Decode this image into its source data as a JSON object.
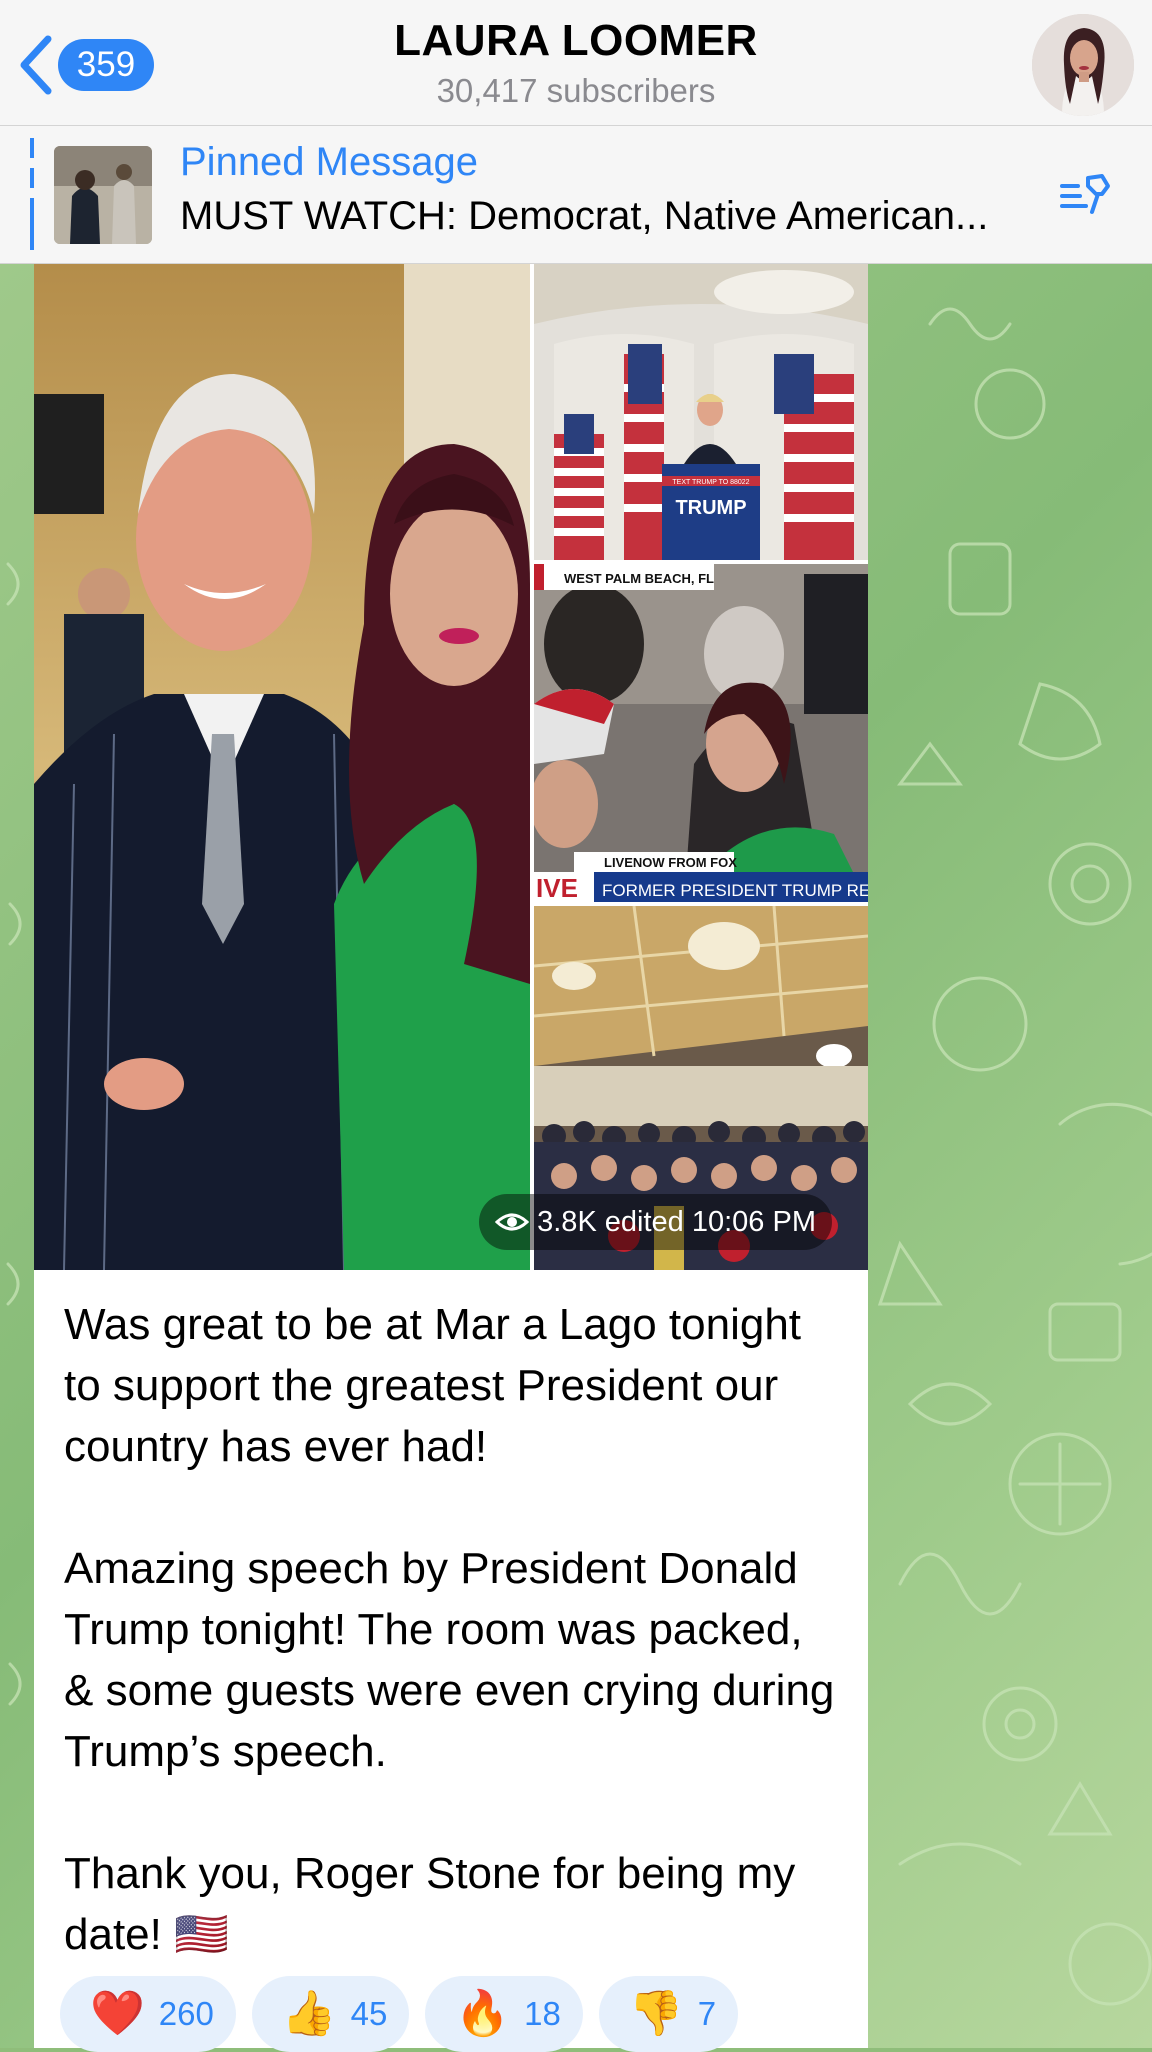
{
  "header": {
    "back_count": "359",
    "channel_name": "LAURA LOOMER",
    "subscribers": "30,417 subscribers",
    "back_icon": "chevron-left-icon",
    "avatar": "channel-avatar"
  },
  "pinned": {
    "label": "Pinned Message",
    "text": "MUST WATCH: Democrat, Native American...",
    "icon": "pinned-list-icon"
  },
  "media": {
    "overlay_top_left": "WEST PALM BEACH, FL",
    "overlay_strap_1": "LIVENOW FROM FOX",
    "overlay_strap_2": "FORMER PRESIDENT TRUMP RESPON",
    "overlay_live": "IVE",
    "podium_text": "TRUMP",
    "podium_small": "TEXT TRUMP TO 88022"
  },
  "message": {
    "views": "3.8K",
    "edited_time": "edited 10:06 PM",
    "paragraphs": [
      "Was great to be at Mar a Lago tonight to support the greatest President our country has ever had!",
      "Amazing speech by President Donald Trump tonight! The room was packed, & some guests were even crying during Trump’s speech.",
      "Thank you, Roger Stone for being my date! 🇺🇸"
    ]
  },
  "reactions": [
    {
      "emoji": "❤️",
      "count": "260",
      "icon": "heart-icon"
    },
    {
      "emoji": "👍",
      "count": "45",
      "icon": "thumbs-up-icon"
    },
    {
      "emoji": "🔥",
      "count": "18",
      "icon": "fire-icon"
    },
    {
      "emoji": "👎",
      "count": "7",
      "icon": "thumbs-down-icon"
    }
  ],
  "colors": {
    "accent": "#2f86f6",
    "chat_bg": "#8fbd7a",
    "header_bg": "#f6f6f6"
  }
}
